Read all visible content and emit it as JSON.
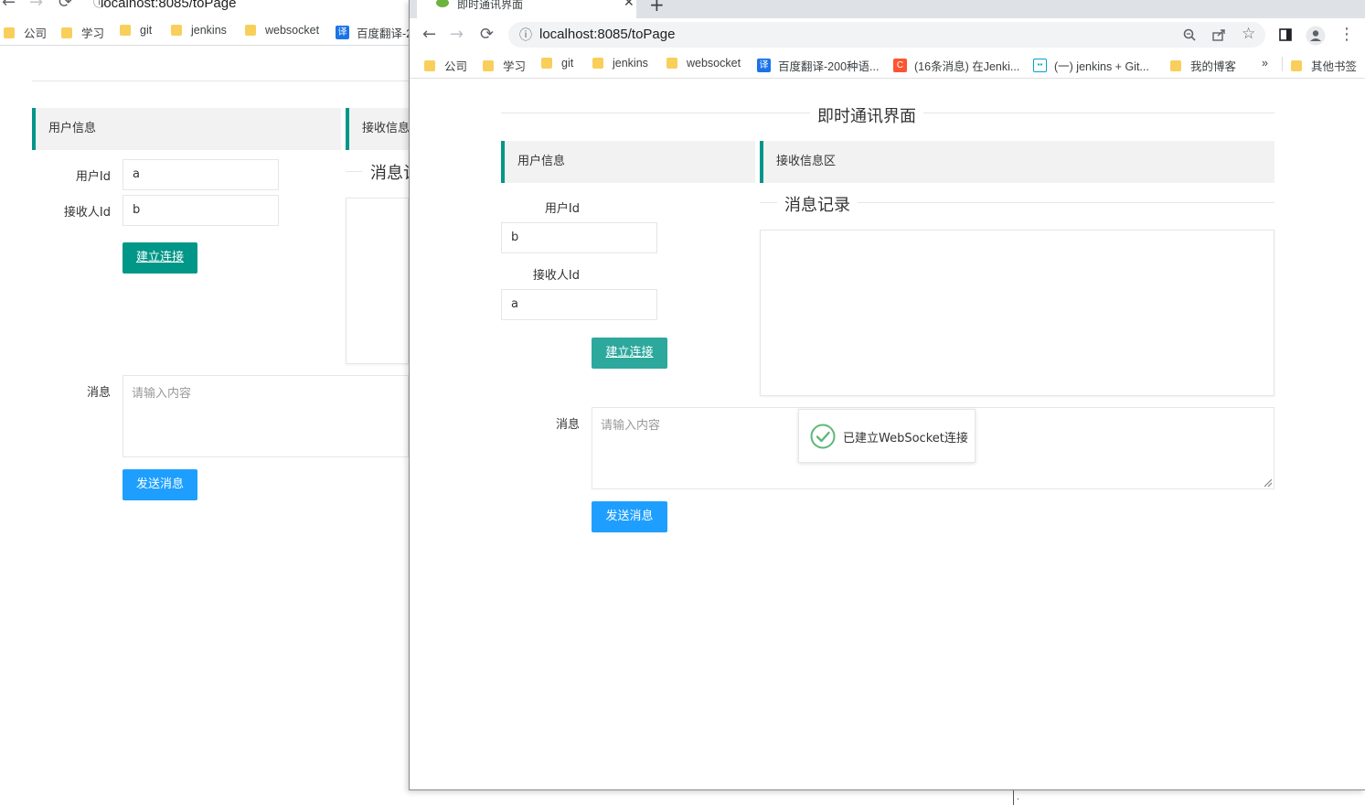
{
  "back_window": {
    "url": "localhost:8085/toPage",
    "bookmarks": [
      "公司",
      "学习",
      "git",
      "jenkins",
      "websocket",
      "百度翻译-2"
    ],
    "user_info_title": "用户信息",
    "receive_title": "接收信息",
    "msg_record_legend": "消息记",
    "user_id_label": "用户Id",
    "user_id_value": "a",
    "receiver_id_label": "接收人Id",
    "receiver_id_value": "b",
    "connect_button": "建立连接",
    "message_label": "消息",
    "message_placeholder": "请输入内容",
    "send_button": "发送消息"
  },
  "front_window": {
    "tab_title": "即时通讯界面",
    "url": "localhost:8085/toPage",
    "bookmarks": {
      "company": "公司",
      "study": "学习",
      "git": "git",
      "jenkins": "jenkins",
      "websocket": "websocket",
      "baidu_translate": "百度翻译-200种语...",
      "csdn": "(16条消息) 在Jenki...",
      "bilibili": "(一) jenkins + Git...",
      "my_blog": "我的博客",
      "more": "»",
      "other_bookmarks": "其他书签"
    },
    "page_title": "即时通讯界面",
    "user_info_title": "用户信息",
    "receive_title": "接收信息区",
    "msg_record_legend": "消息记录",
    "user_id_label": "用户Id",
    "user_id_value": "b",
    "receiver_id_label": "接收人Id",
    "receiver_id_value": "a",
    "connect_button": "建立连接",
    "message_label": "消息",
    "message_placeholder": "请输入内容",
    "send_button": "发送消息",
    "toast_text": "已建立WebSocket连接"
  },
  "colors": {
    "primary_green": "#009688",
    "primary_blue": "#1e9fff",
    "bookmark_folder": "#f8cf5b"
  }
}
